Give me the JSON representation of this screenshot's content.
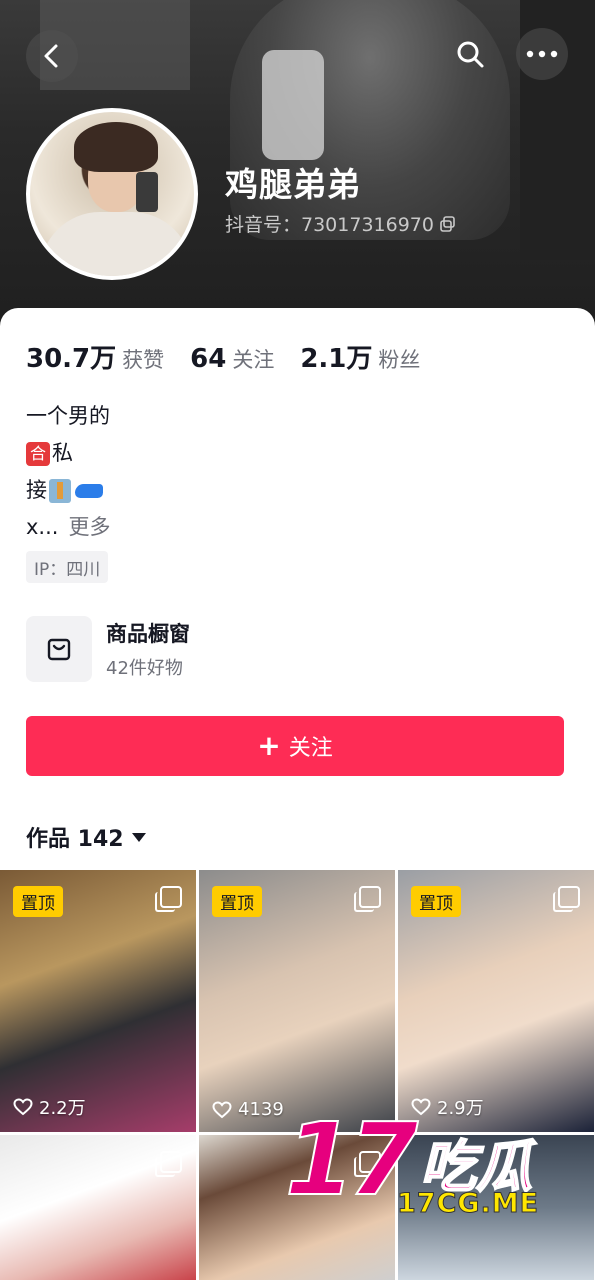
{
  "header": {
    "back_icon": "back-arrow-icon",
    "search_icon": "search-icon",
    "more_icon": "more-dots-icon"
  },
  "profile": {
    "nickname": "鸡腿弟弟",
    "douyin_id": "抖音号：73017316970",
    "copy_icon": "copy-icon"
  },
  "stats": [
    {
      "value": "30.7万",
      "label": "获赞"
    },
    {
      "value": "64",
      "label": "关注"
    },
    {
      "value": "2.1万",
      "label": "粉丝"
    }
  ],
  "bio": {
    "line1": "一个男的",
    "line2_tag": "合",
    "line2_text": "私",
    "line3_text": "接",
    "line4_text": "x...",
    "more": "更多"
  },
  "ip": "IP：四川",
  "shop": {
    "title": "商品橱窗",
    "subtitle": "42件好物",
    "icon": "shopping-bag-icon"
  },
  "follow_button": {
    "plus": "+",
    "label": "关注",
    "color": "#fe2c55"
  },
  "works_tab": {
    "label": "作品 142"
  },
  "grid": [
    {
      "pinned": "置顶",
      "likes": "2.2万"
    },
    {
      "pinned": "置顶",
      "likes": "4139"
    },
    {
      "pinned": "置顶",
      "likes": "2.9万"
    },
    {
      "pinned": "",
      "likes": ""
    },
    {
      "pinned": "",
      "likes": ""
    },
    {
      "pinned": "",
      "likes": ""
    }
  ],
  "watermark": {
    "big": "17",
    "cn": "吃瓜",
    "url": "17CG.ME"
  }
}
